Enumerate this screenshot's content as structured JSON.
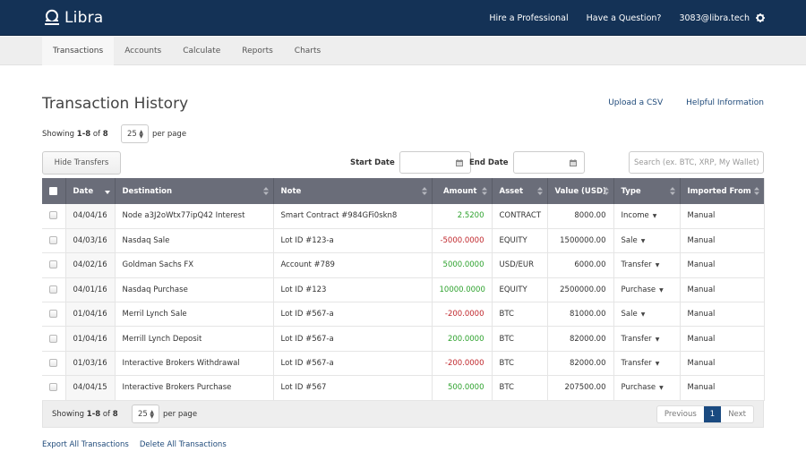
{
  "app": {
    "brand": "Libra",
    "top_links": [
      "Hire a Professional",
      "Have a Question?",
      "3083@libra.tech"
    ],
    "user_email": "3083@libra.tech"
  },
  "nav": {
    "tabs": [
      {
        "label": "Transactions",
        "active": true
      },
      {
        "label": "Accounts",
        "active": false
      },
      {
        "label": "Calculate",
        "active": false
      },
      {
        "label": "Reports",
        "active": false
      },
      {
        "label": "Charts",
        "active": false
      }
    ]
  },
  "page": {
    "title": "Transaction History",
    "upload_link": "Upload a CSV",
    "help_link": "Helpful Information",
    "showing_prefix": "Showing ",
    "showing_range": "1-8",
    "showing_of": " of ",
    "showing_total": "8",
    "per_page_value": "25",
    "per_page_label": "per page",
    "hide_transfers": "Hide Transfers",
    "start_date_label": "Start Date",
    "end_date_label": "End Date",
    "start_date_value": "",
    "end_date_value": "",
    "search_placeholder": "Search (ex. BTC, XRP, My Wallet)"
  },
  "table": {
    "columns": [
      "Date",
      "Destination",
      "Note",
      "Amount",
      "Asset",
      "Value (USD)",
      "Type",
      "Imported From"
    ],
    "rows": [
      {
        "date": "04/04/16",
        "destination": "Node a3J2oWtx77ipQ42 Interest",
        "note": "Smart Contract #984GFi0skn8",
        "amount": "2.5200",
        "sign": "pos",
        "asset": "CONTRACT",
        "value": "8000.00",
        "type": "Income",
        "imported": "Manual"
      },
      {
        "date": "04/03/16",
        "destination": "Nasdaq Sale",
        "note": "Lot ID #123-a",
        "amount": "-5000.0000",
        "sign": "neg",
        "asset": "EQUITY",
        "value": "1500000.00",
        "type": "Sale",
        "imported": "Manual"
      },
      {
        "date": "04/02/16",
        "destination": "Goldman Sachs FX",
        "note": "Account #789",
        "amount": "5000.0000",
        "sign": "pos",
        "asset": "USD/EUR",
        "value": "6000.00",
        "type": "Transfer",
        "imported": "Manual"
      },
      {
        "date": "04/01/16",
        "destination": "Nasdaq Purchase",
        "note": "Lot ID #123",
        "amount": "10000.0000",
        "sign": "pos",
        "asset": "EQUITY",
        "value": "2500000.00",
        "type": "Purchase",
        "imported": "Manual"
      },
      {
        "date": "01/04/16",
        "destination": "Merril Lynch Sale",
        "note": "Lot ID #567-a",
        "amount": "-200.0000",
        "sign": "neg",
        "asset": "BTC",
        "value": "81000.00",
        "type": "Sale",
        "imported": "Manual"
      },
      {
        "date": "01/04/16",
        "destination": "Merrill Lynch Deposit",
        "note": "Lot ID #567-a",
        "amount": "200.0000",
        "sign": "pos",
        "asset": "BTC",
        "value": "82000.00",
        "type": "Transfer",
        "imported": "Manual"
      },
      {
        "date": "01/03/16",
        "destination": "Interactive Brokers Withdrawal",
        "note": "Lot ID #567-a",
        "amount": "-200.0000",
        "sign": "neg",
        "asset": "BTC",
        "value": "82000.00",
        "type": "Transfer",
        "imported": "Manual"
      },
      {
        "date": "04/04/15",
        "destination": "Interactive Brokers Purchase",
        "note": "Lot ID #567",
        "amount": "500.0000",
        "sign": "pos",
        "asset": "BTC",
        "value": "207500.00",
        "type": "Purchase",
        "imported": "Manual"
      }
    ]
  },
  "pagination": {
    "previous": "Previous",
    "current": "1",
    "next": "Next"
  },
  "footer": {
    "export": "Export All Transactions",
    "delete": "Delete All Transactions"
  },
  "colors": {
    "topbar": "#143256",
    "header": "#6a6d79",
    "positive": "#2ea22e",
    "negative": "#c0282d",
    "link": "#1f4a7a",
    "active_page": "#1a4a80"
  }
}
